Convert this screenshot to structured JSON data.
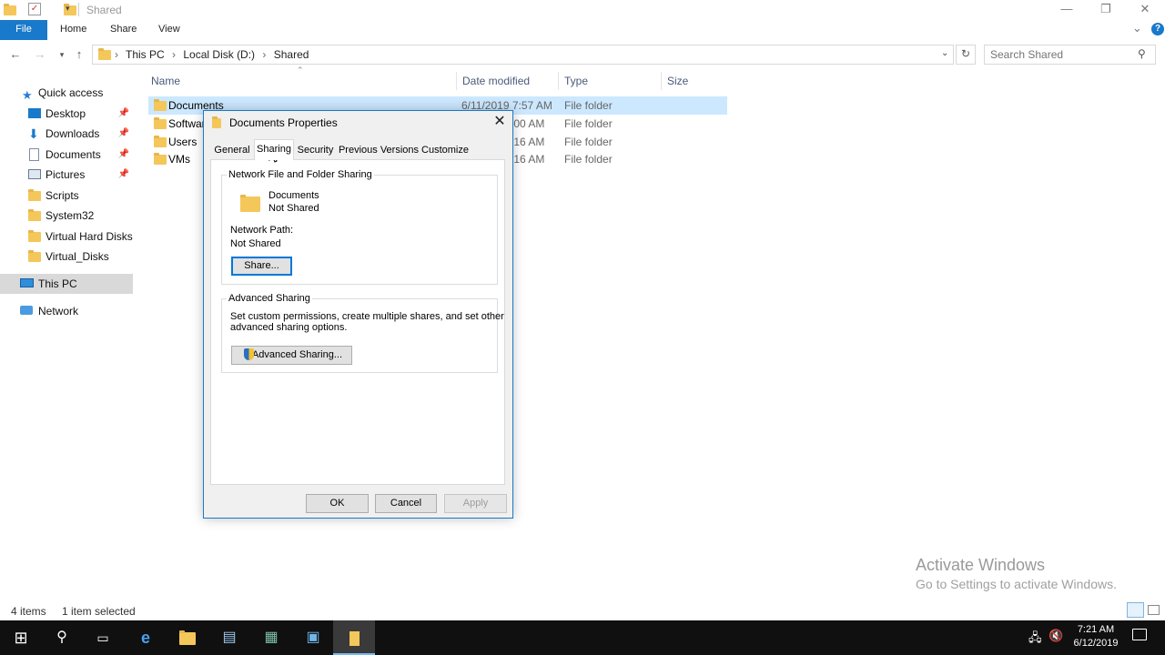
{
  "window": {
    "title": "Shared",
    "minimize_glyph": "—",
    "restore_glyph": "❐",
    "close_glyph": "✕",
    "collapse_glyph": "⌄",
    "help_glyph": "?"
  },
  "ribbon": {
    "file": "File",
    "home": "Home",
    "share": "Share",
    "view": "View"
  },
  "address": {
    "crumbs": [
      "This PC",
      "Local Disk (D:)",
      "Shared"
    ],
    "separator": "›",
    "search_placeholder": "Search Shared"
  },
  "nav_pane": {
    "quick_access": "Quick access",
    "items": [
      "Desktop",
      "Downloads",
      "Documents",
      "Pictures",
      "Scripts",
      "System32",
      "Virtual Hard Disks",
      "Virtual_Disks"
    ],
    "this_pc": "This PC",
    "network": "Network"
  },
  "columns": {
    "name": "Name",
    "date_modified": "Date modified",
    "type": "Type",
    "size": "Size"
  },
  "files": [
    {
      "name": "Documents",
      "date": "6/11/2019 7:57 AM",
      "type": "File folder"
    },
    {
      "name": "Software",
      "date": ":00 AM",
      "type": "File folder"
    },
    {
      "name": "Users",
      "date": ":16 AM",
      "type": "File folder"
    },
    {
      "name": "VMs",
      "date": ":16 AM",
      "type": "File folder"
    }
  ],
  "dialog": {
    "title": "Documents Properties",
    "tabs": [
      "General",
      "Sharing",
      "Security",
      "Previous Versions",
      "Customize"
    ],
    "active_tab": "Sharing",
    "network_group_title": "Network File and Folder Sharing",
    "folder_name": "Documents",
    "share_state": "Not Shared",
    "network_path_label": "Network Path:",
    "network_path_value": "Not Shared",
    "share_button": "Share...",
    "advanced_group_title": "Advanced Sharing",
    "advanced_desc_1": "Set custom permissions, create multiple shares, and set other",
    "advanced_desc_2": "advanced sharing options.",
    "advanced_button": "Advanced Sharing...",
    "ok": "OK",
    "cancel": "Cancel",
    "apply": "Apply"
  },
  "status_bar": {
    "count": "4 items",
    "selected": "1 item selected"
  },
  "watermark": {
    "line1": "Activate Windows",
    "line2": "Go to Settings to activate Windows."
  },
  "taskbar": {
    "time": "7:21 AM",
    "date": "6/12/2019"
  },
  "colors": {
    "accent": "#1979ca",
    "selection": "#cce8ff",
    "folder": "#f4c75a",
    "taskbar": "#101010"
  }
}
